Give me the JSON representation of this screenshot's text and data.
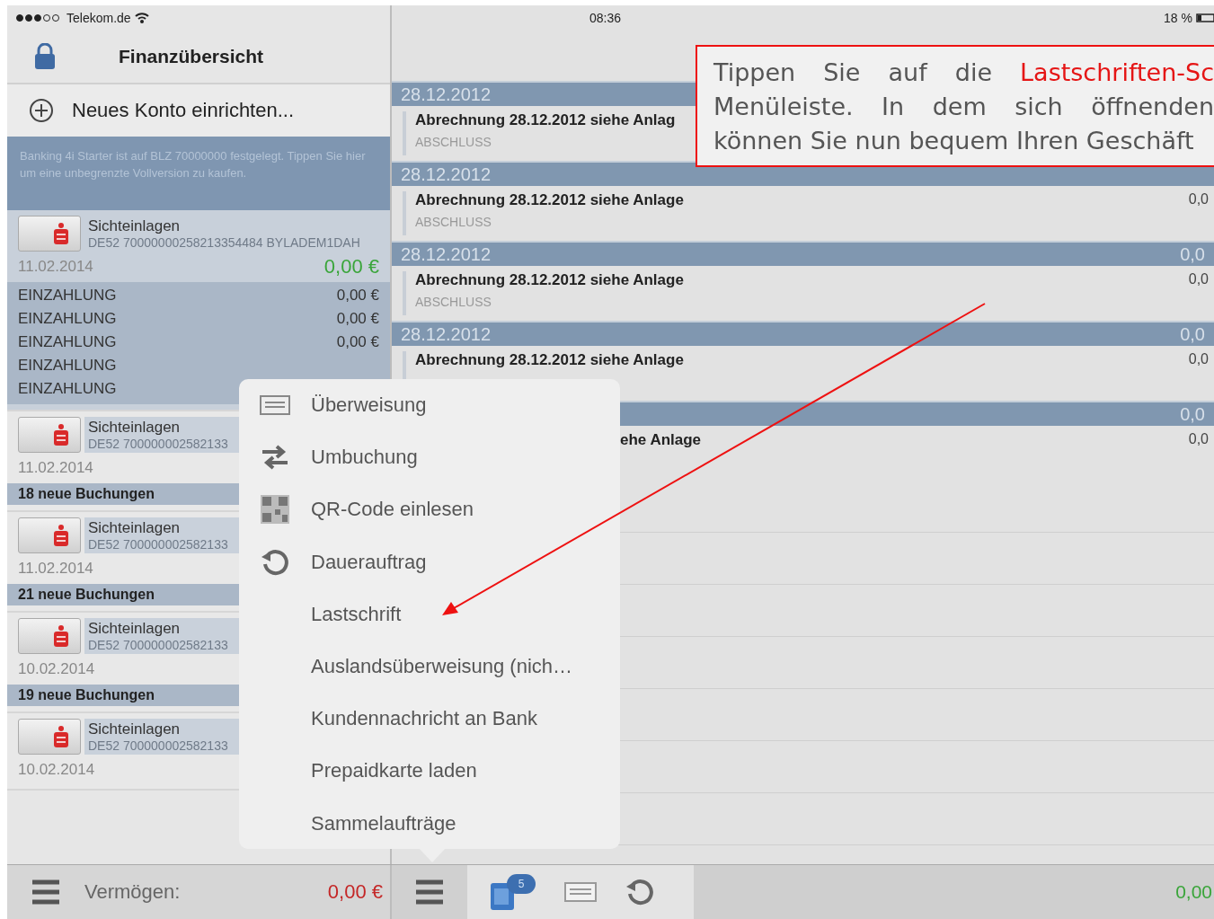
{
  "status_bar": {
    "carrier": "Telekom.de",
    "time": "08:36",
    "battery": "18 %"
  },
  "sidebar": {
    "title": "Finanzübersicht",
    "add_account": "Neues Konto einrichten...",
    "notice": "Banking 4i Starter ist auf BLZ 70000000 festgelegt. Tippen Sie hier um eine unbegrenzte Vollversion zu kaufen.",
    "accounts": [
      {
        "name": "Sichteinlagen",
        "iban": "DE52 70000000258213354484 BYLADEM1DAH",
        "date": "11.02.2014",
        "balance": "0,00 €",
        "expanded": true,
        "bookings": [
          {
            "label": "EINZAHLUNG",
            "amount": "0,00 €"
          },
          {
            "label": "EINZAHLUNG",
            "amount": "0,00 €"
          },
          {
            "label": "EINZAHLUNG",
            "amount": "0,00 €"
          },
          {
            "label": "EINZAHLUNG"
          },
          {
            "label": "EINZAHLUNG"
          }
        ]
      },
      {
        "name": "Sichteinlagen",
        "iban": "DE52 700000002582133",
        "date": "11.02.2014",
        "expanded": false,
        "new_bookings": "18 neue Buchungen"
      },
      {
        "name": "Sichteinlagen",
        "iban": "DE52 700000002582133",
        "date": "11.02.2014",
        "expanded": false,
        "new_bookings": "21 neue Buchungen"
      },
      {
        "name": "Sichteinlagen",
        "iban": "DE52 700000002582133",
        "date": "10.02.2014",
        "expanded": false,
        "new_bookings": "19 neue Buchungen"
      },
      {
        "name": "Sichteinlagen",
        "iban": "DE52 700000002582133",
        "date": "10.02.2014",
        "expanded": false
      }
    ]
  },
  "transactions": [
    {
      "date": "28.12.2012",
      "entry": {
        "title": "Abrechnung 28.12.2012 siehe Anlag",
        "subtitle": "ABSCHLUSS"
      }
    },
    {
      "date": "28.12.2012",
      "entry": {
        "title": "Abrechnung 28.12.2012 siehe Anlage",
        "subtitle": "ABSCHLUSS",
        "amount": "0,0"
      }
    },
    {
      "date": "28.12.2012",
      "amount": "0,0",
      "entry": {
        "title": "Abrechnung 28.12.2012 siehe Anlage",
        "subtitle": "ABSCHLUSS",
        "amount": "0,0"
      }
    },
    {
      "date": "28.12.2012",
      "amount": "0,0",
      "entry": {
        "title": "Abrechnung 28.12.2012 siehe Anlage",
        "amount": "0,0"
      }
    },
    {
      "amount": "0,0",
      "entry": {
        "title": "ehe Anlage",
        "kind": "partial",
        "amount": "0,0"
      }
    }
  ],
  "menu": {
    "items": [
      {
        "label": "Überweisung",
        "kind": "form"
      },
      {
        "label": "Umbuchung",
        "kind": "swap"
      },
      {
        "label": "QR-Code einlesen",
        "kind": "qr"
      },
      {
        "label": "Dauerauftrag",
        "kind": "repeat"
      },
      {
        "label": "Lastschrift",
        "kind": "plain"
      },
      {
        "label": "Auslandsüberweisung (nich…",
        "kind": "plain"
      },
      {
        "label": "Kundennachricht an Bank",
        "kind": "plain"
      },
      {
        "label": "Prepaidkarte laden",
        "kind": "plain"
      },
      {
        "label": "Sammelaufträge",
        "kind": "plain"
      }
    ]
  },
  "bottom_bar": {
    "label": "Vermögen:",
    "total": "0,00 €",
    "badge": "5",
    "balance": "0,00"
  },
  "callout": {
    "lines": [
      [
        {
          "text": "Tippen Sie auf die ",
          "highlight": false
        },
        {
          "text": "Lastschriften-Sc",
          "highlight": true
        }
      ],
      [
        {
          "text": "Menüleiste. In dem sich öffnenden",
          "highlight": false
        }
      ],
      [
        {
          "text": "können Sie nun bequem Ihren Geschäft",
          "highlight": false
        }
      ]
    ]
  }
}
